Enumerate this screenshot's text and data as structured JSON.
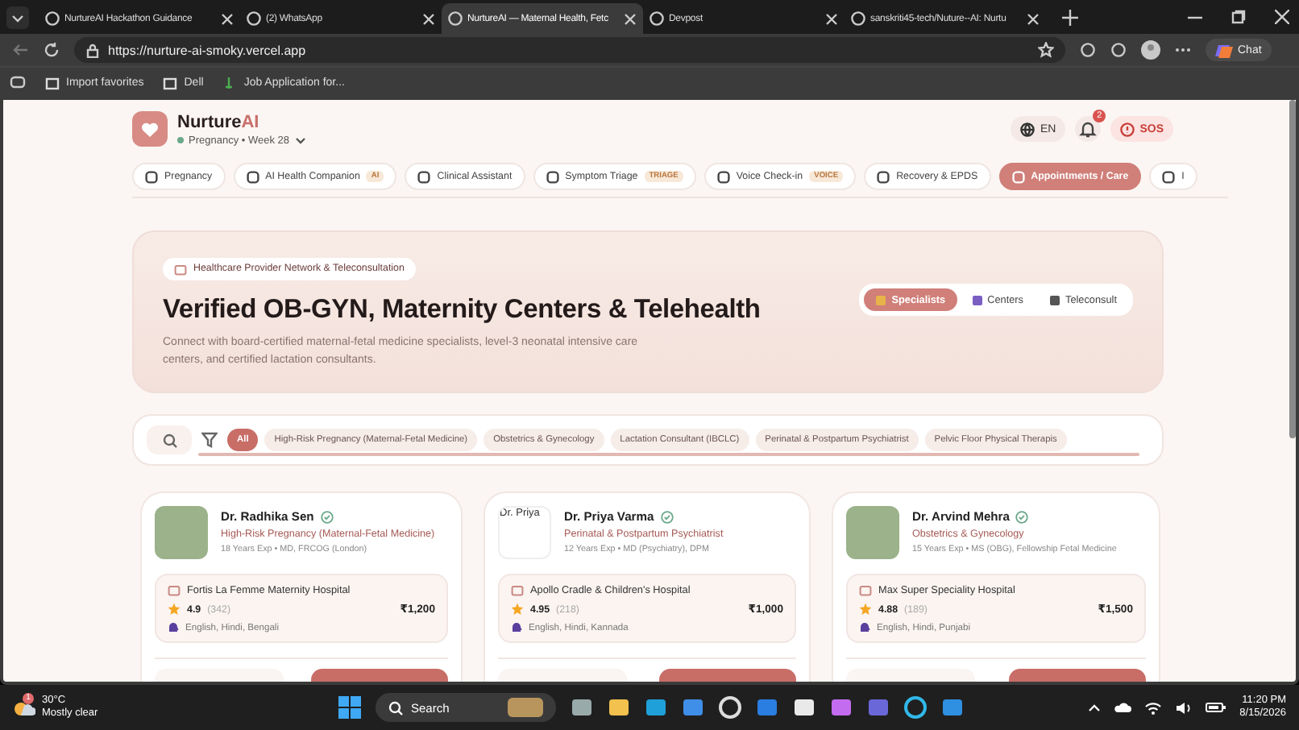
{
  "browser": {
    "tabs": [
      {
        "title": "NurtureAI Hackathon Guidance",
        "selected": false
      },
      {
        "title": "(2) WhatsApp",
        "selected": false
      },
      {
        "title": "NurtureAI — Maternal Health, Fetc",
        "selected": true
      },
      {
        "title": "Devpost",
        "selected": false
      },
      {
        "title": "sanskriti45-tech/Nuture--AI: Nurtu",
        "selected": false
      }
    ],
    "url": "https://nurture-ai-smoky.vercel.app",
    "chat": "Chat",
    "bookmarks": [
      "Import favorites",
      "Dell",
      "Job Application for..."
    ]
  },
  "header": {
    "brand_main": "Nurture",
    "brand_accent": "AI",
    "stage": "Pregnancy • Week 28",
    "language": "EN",
    "notifications": "2",
    "sos": "SOS"
  },
  "nav_tabs": [
    {
      "label": "Pregnancy",
      "selected": false
    },
    {
      "label": "AI Health Companion",
      "badge": "AI",
      "selected": false
    },
    {
      "label": "Clinical Assistant",
      "selected": false
    },
    {
      "label": "Symptom Triage",
      "badge": "TRIAGE",
      "selected": false
    },
    {
      "label": "Voice Check-in",
      "badge": "VOICE",
      "selected": false
    },
    {
      "label": "Recovery & EPDS",
      "selected": false
    },
    {
      "label": "Appointments / Care",
      "selected": true
    },
    {
      "label": "I",
      "selected": false
    }
  ],
  "hero": {
    "tag": "Healthcare Provider Network & Teleconsultation",
    "title": "Verified OB-GYN, Maternity Centers & Telehealth",
    "description": "Connect with board-certified maternal-fetal medicine specialists, level-3 neonatal intensive care centers, and certified lactation consultants.",
    "segments": [
      {
        "label": "Specialists",
        "selected": true
      },
      {
        "label": "Centers",
        "selected": false
      },
      {
        "label": "Teleconsult",
        "selected": false
      }
    ]
  },
  "filters": [
    {
      "label": "All",
      "selected": true
    },
    {
      "label": "High-Risk Pregnancy (Maternal-Fetal Medicine)",
      "selected": false
    },
    {
      "label": "Obstetrics & Gynecology",
      "selected": false
    },
    {
      "label": "Lactation Consultant (IBCLC)",
      "selected": false
    },
    {
      "label": "Perinatal & Postpartum Psychiatrist",
      "selected": false
    },
    {
      "label": "Pelvic Floor Physical Therapis",
      "selected": false
    }
  ],
  "doctors": [
    {
      "name": "Dr. Radhika Sen",
      "specialty": "High-Risk Pregnancy (Maternal-Fetal Medicine)",
      "experience": "18 Years Exp • MD, FRCOG (London)",
      "hospital": "Fortis La Femme Maternity Hospital",
      "rating": "4.9",
      "reviews": "(342)",
      "fee": "₹1,200",
      "languages": "English, Hindi, Bengali"
    },
    {
      "name": "Dr. Priya Varma",
      "photo_alt": "Dr. Priya",
      "specialty": "Perinatal & Postpartum Psychiatrist",
      "experience": "12 Years Exp • MD (Psychiatry), DPM",
      "hospital": "Apollo Cradle & Children's Hospital",
      "rating": "4.95",
      "reviews": "(218)",
      "fee": "₹1,000",
      "languages": "English, Hindi, Kannada"
    },
    {
      "name": "Dr. Arvind Mehra",
      "specialty": "Obstetrics & Gynecology",
      "experience": "15 Years Exp • MS (OBG), Fellowship Fetal Medicine",
      "hospital": "Max Super Speciality Hospital",
      "rating": "4.88",
      "reviews": "(189)",
      "fee": "₹1,500",
      "languages": "English, Hindi, Punjabi"
    }
  ],
  "taskbar": {
    "temperature": "30°C",
    "weather": "Mostly clear",
    "weather_badge": "1",
    "search": "Search",
    "time": "11:20 PM",
    "date": "8/15/2026"
  }
}
